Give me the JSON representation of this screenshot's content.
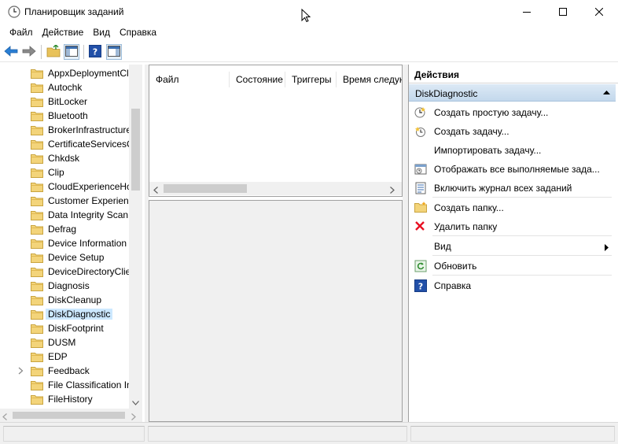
{
  "window": {
    "title": "Планировщик заданий",
    "icon": "clock-app-icon"
  },
  "menu": [
    {
      "label": "Файл"
    },
    {
      "label": "Действие"
    },
    {
      "label": "Вид"
    },
    {
      "label": "Справка"
    }
  ],
  "toolbar": {
    "buttons": [
      "back-arrow-icon",
      "forward-arrow-icon",
      "up-folder-icon",
      "show-hide-console-tree-icon",
      "help-icon",
      "show-action-pane-icon"
    ]
  },
  "tree": {
    "items": [
      {
        "label": "AppxDeploymentCl",
        "expandable": false
      },
      {
        "label": "Autochk",
        "expandable": false
      },
      {
        "label": "BitLocker",
        "expandable": false
      },
      {
        "label": "Bluetooth",
        "expandable": false
      },
      {
        "label": "BrokerInfrastructure",
        "expandable": false
      },
      {
        "label": "CertificateServicesC",
        "expandable": false
      },
      {
        "label": "Chkdsk",
        "expandable": false
      },
      {
        "label": "Clip",
        "expandable": false
      },
      {
        "label": "CloudExperienceHc",
        "expandable": false
      },
      {
        "label": "Customer Experienc",
        "expandable": false
      },
      {
        "label": "Data Integrity Scan",
        "expandable": false
      },
      {
        "label": "Defrag",
        "expandable": false
      },
      {
        "label": "Device Information",
        "expandable": false
      },
      {
        "label": "Device Setup",
        "expandable": false
      },
      {
        "label": "DeviceDirectoryClie",
        "expandable": false
      },
      {
        "label": "Diagnosis",
        "expandable": false
      },
      {
        "label": "DiskCleanup",
        "expandable": false
      },
      {
        "label": "DiskDiagnostic",
        "expandable": false,
        "selected": true
      },
      {
        "label": "DiskFootprint",
        "expandable": false
      },
      {
        "label": "DUSM",
        "expandable": false
      },
      {
        "label": "EDP",
        "expandable": false
      },
      {
        "label": "Feedback",
        "expandable": true
      },
      {
        "label": "File Classification In",
        "expandable": false
      },
      {
        "label": "FileHistory",
        "expandable": false
      }
    ]
  },
  "task_list": {
    "columns": [
      "Файл",
      "Состояние",
      "Триггеры",
      "Время следую"
    ]
  },
  "actions": {
    "title": "Действия",
    "group": "DiskDiagnostic",
    "items": [
      {
        "label": "Создать простую задачу...",
        "icon": "create-basic-task-icon"
      },
      {
        "label": "Создать задачу...",
        "icon": "create-task-icon"
      },
      {
        "label": "Импортировать задачу...",
        "icon": ""
      },
      {
        "label": "Отображать все выполняемые зада...",
        "icon": "running-tasks-icon"
      },
      {
        "label": "Включить журнал всех заданий",
        "icon": "enable-history-icon"
      },
      {
        "label": "Создать папку...",
        "icon": "new-folder-icon"
      },
      {
        "label": "Удалить папку",
        "icon": "delete-icon"
      },
      {
        "label": "Вид",
        "icon": "",
        "submenu": true
      },
      {
        "label": "Обновить",
        "icon": "refresh-icon"
      },
      {
        "label": "Справка",
        "icon": "help-icon"
      }
    ]
  },
  "colors": {
    "selection": "#cce8ff",
    "group_header": "#c3d8ec",
    "delete_red": "#e81123"
  }
}
